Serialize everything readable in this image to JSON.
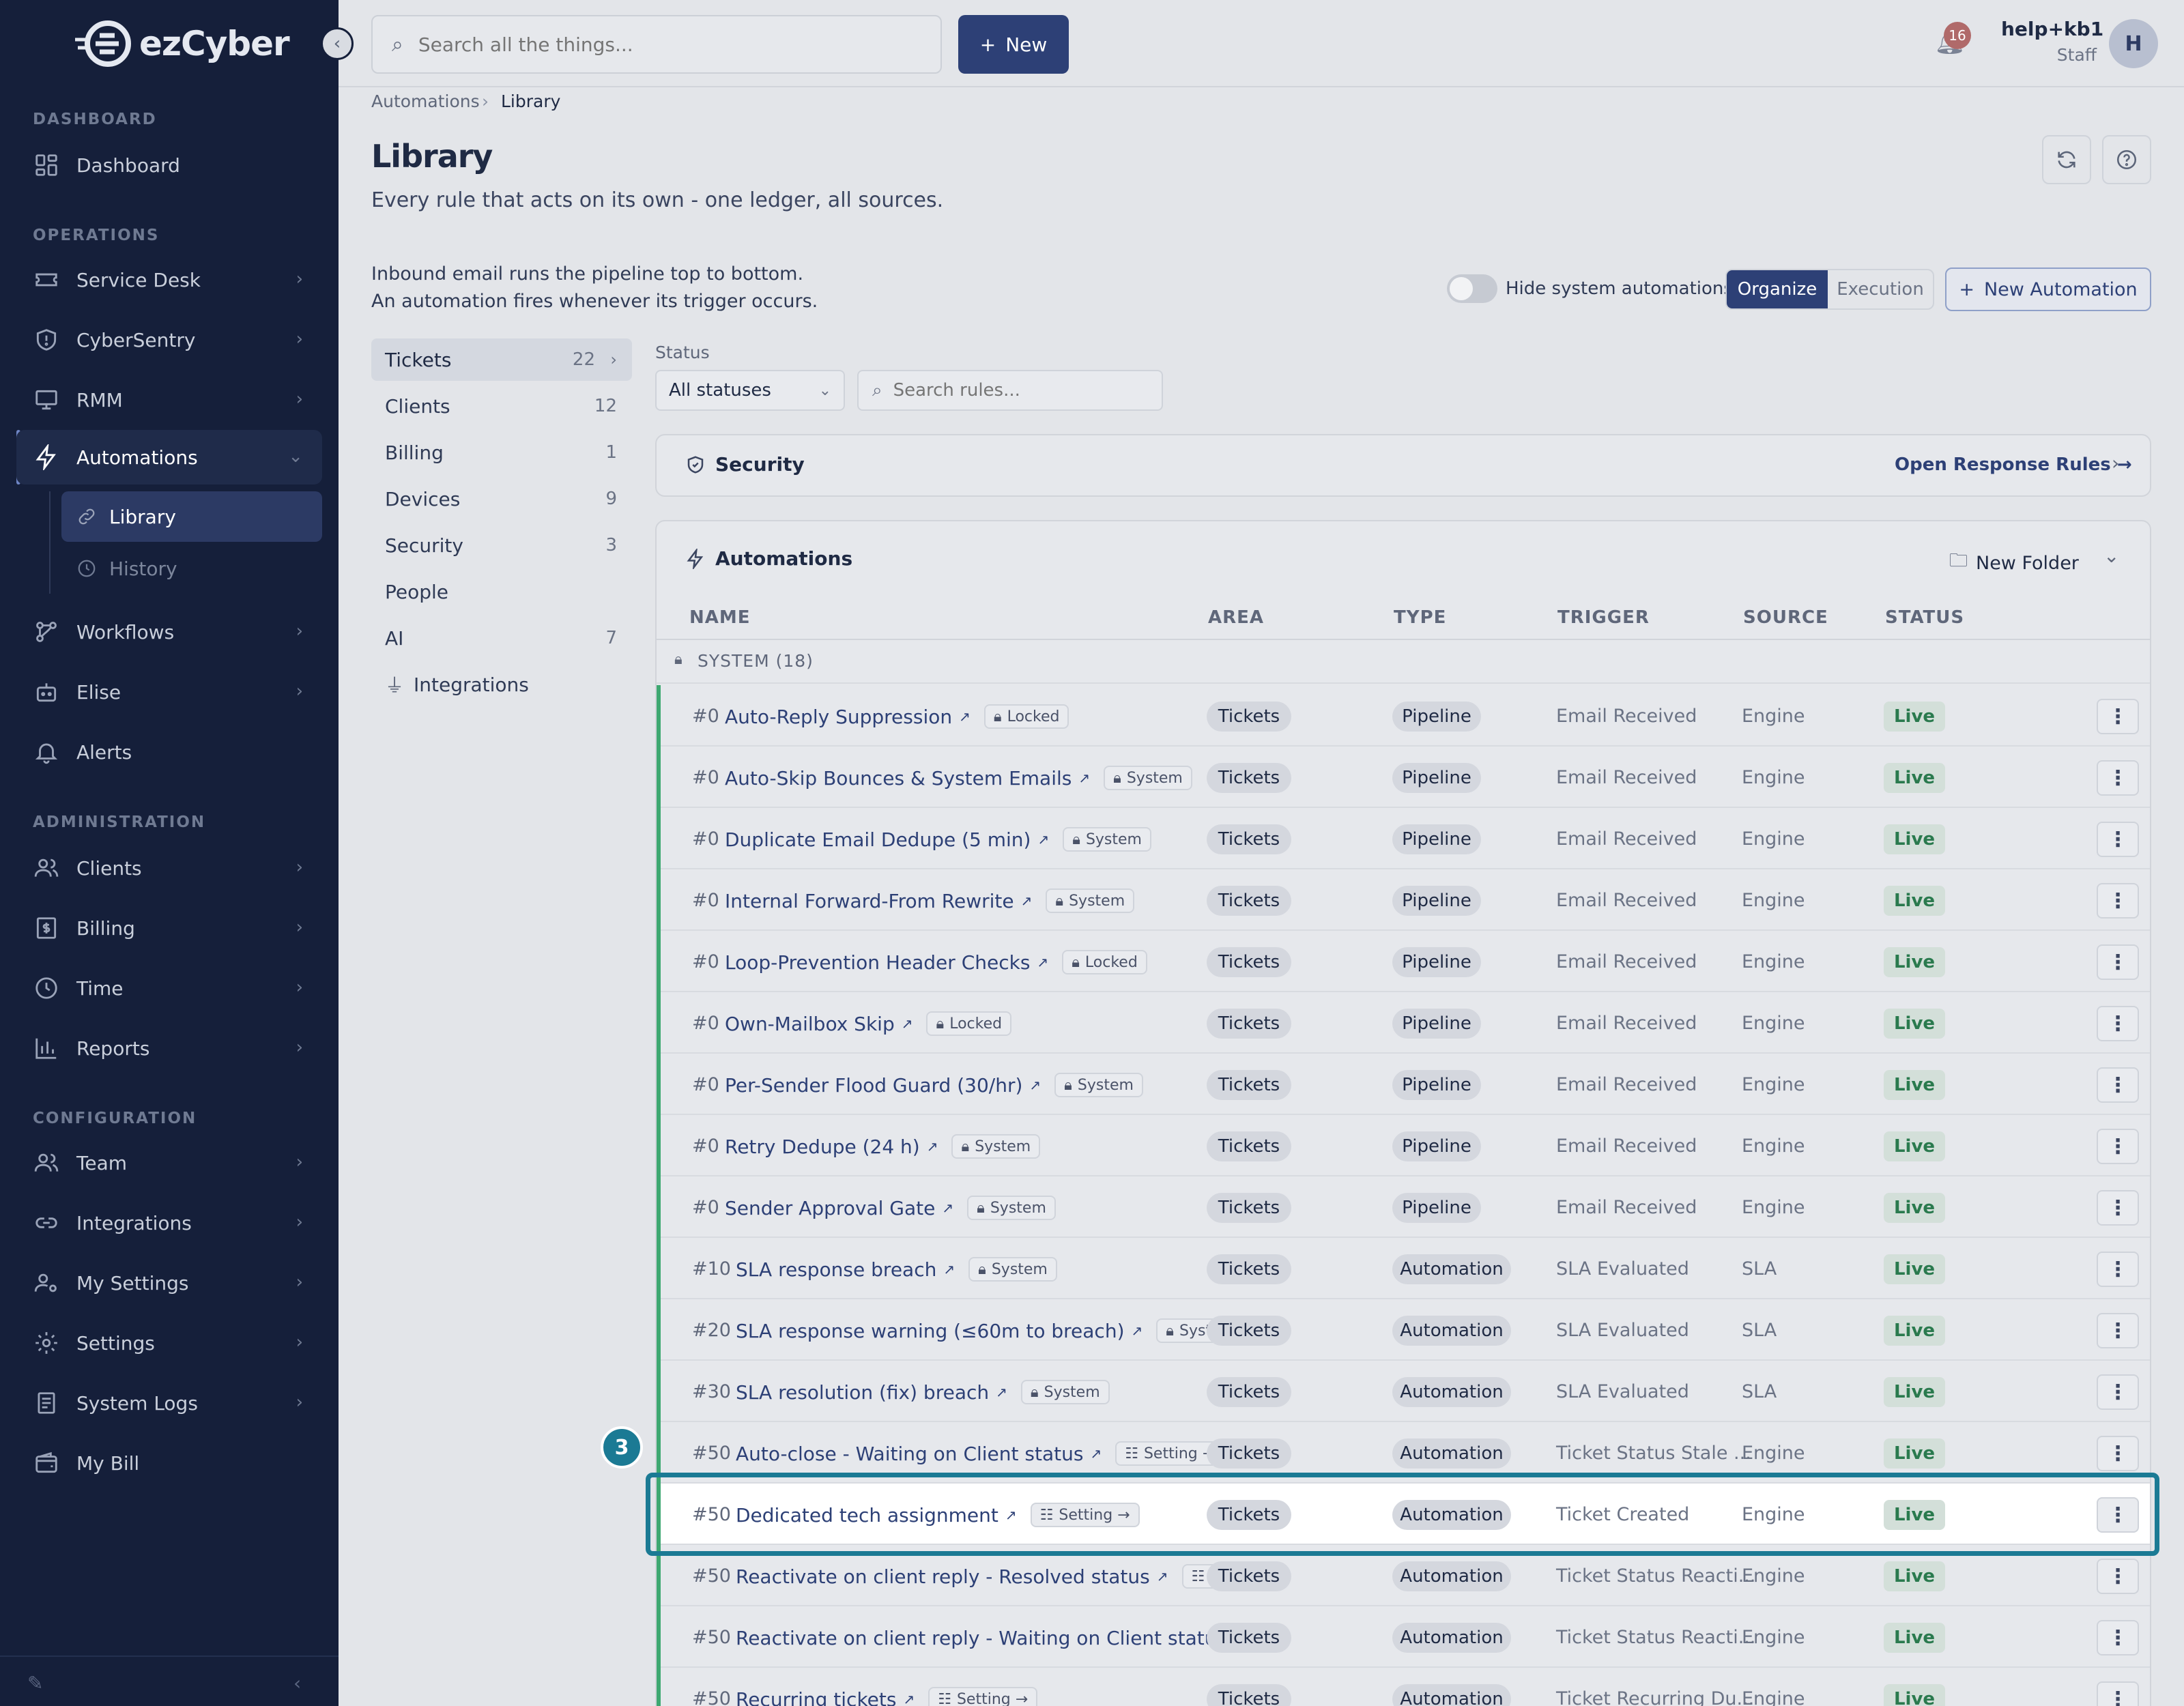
{
  "brand": {
    "logo_text": "ezCyber"
  },
  "sidebar": {
    "sections": {
      "dashboard": "DASHBOARD",
      "operations": "OPERATIONS",
      "administration": "ADMINISTRATION",
      "configuration": "CONFIGURATION"
    },
    "items": [
      {
        "label": "Dashboard"
      },
      {
        "label": "Service Desk"
      },
      {
        "label": "CyberSentry"
      },
      {
        "label": "RMM"
      },
      {
        "label": "Automations"
      },
      {
        "label": "Workflows"
      },
      {
        "label": "Elise"
      },
      {
        "label": "Alerts"
      },
      {
        "label": "Clients"
      },
      {
        "label": "Billing"
      },
      {
        "label": "Time"
      },
      {
        "label": "Reports"
      },
      {
        "label": "Team"
      },
      {
        "label": "Integrations"
      },
      {
        "label": "My Settings"
      },
      {
        "label": "Settings"
      },
      {
        "label": "System Logs"
      },
      {
        "label": "My Bill"
      }
    ],
    "sub_items": [
      {
        "label": "Library"
      },
      {
        "label": "History"
      }
    ]
  },
  "topbar": {
    "search_placeholder": "Search all the things...",
    "new_label": "New",
    "notification_count": "16",
    "user_name": "help+kb1",
    "user_role": "Staff",
    "avatar_initial": "H"
  },
  "breadcrumb": {
    "parent": "Automations",
    "current": "Library"
  },
  "page": {
    "title": "Library",
    "subtitle": "Every rule that acts on its own - one ledger, all sources.",
    "info_line1": "Inbound email runs the pipeline top to bottom.",
    "info_line2": "An automation fires whenever its trigger occurs."
  },
  "controls": {
    "hide_system_label": "Hide system automations",
    "hide_system_on": false,
    "mode_organize": "Organize",
    "mode_execution": "Execution",
    "new_automation": "New Automation"
  },
  "categories": [
    {
      "label": "Tickets",
      "count": "22"
    },
    {
      "label": "Clients",
      "count": "12"
    },
    {
      "label": "Billing",
      "count": "1"
    },
    {
      "label": "Devices",
      "count": "9"
    },
    {
      "label": "Security",
      "count": "3"
    },
    {
      "label": "People",
      "count": ""
    },
    {
      "label": "AI",
      "count": "7"
    },
    {
      "label": "Integrations",
      "count": ""
    }
  ],
  "filters": {
    "status_label": "Status",
    "status_value": "All statuses",
    "search_placeholder": "Search rules..."
  },
  "security_panel": {
    "title": "Security",
    "link": "Open Response Rules"
  },
  "automations_panel": {
    "title": "Automations",
    "new_folder": "New Folder"
  },
  "table": {
    "headers": {
      "name": "NAME",
      "area": "AREA",
      "type": "TYPE",
      "trigger": "TRIGGER",
      "source": "SOURCE",
      "status": "STATUS"
    },
    "group": "SYSTEM  (18)",
    "rows": [
      {
        "num": "#0",
        "name": "Auto-Reply Suppression",
        "tag": "Locked",
        "area": "Tickets",
        "type": "Pipeline",
        "trigger": "Email Received",
        "source": "Engine",
        "status": "Live"
      },
      {
        "num": "#0",
        "name": "Auto-Skip Bounces & System Emails",
        "tag": "System",
        "area": "Tickets",
        "type": "Pipeline",
        "trigger": "Email Received",
        "source": "Engine",
        "status": "Live"
      },
      {
        "num": "#0",
        "name": "Duplicate Email Dedupe (5 min)",
        "tag": "System",
        "area": "Tickets",
        "type": "Pipeline",
        "trigger": "Email Received",
        "source": "Engine",
        "status": "Live"
      },
      {
        "num": "#0",
        "name": "Internal Forward-From Rewrite",
        "tag": "System",
        "area": "Tickets",
        "type": "Pipeline",
        "trigger": "Email Received",
        "source": "Engine",
        "status": "Live"
      },
      {
        "num": "#0",
        "name": "Loop-Prevention Header Checks",
        "tag": "Locked",
        "area": "Tickets",
        "type": "Pipeline",
        "trigger": "Email Received",
        "source": "Engine",
        "status": "Live"
      },
      {
        "num": "#0",
        "name": "Own-Mailbox Skip",
        "tag": "Locked",
        "area": "Tickets",
        "type": "Pipeline",
        "trigger": "Email Received",
        "source": "Engine",
        "status": "Live"
      },
      {
        "num": "#0",
        "name": "Per-Sender Flood Guard (30/hr)",
        "tag": "System",
        "area": "Tickets",
        "type": "Pipeline",
        "trigger": "Email Received",
        "source": "Engine",
        "status": "Live"
      },
      {
        "num": "#0",
        "name": "Retry Dedupe (24 h)",
        "tag": "System",
        "area": "Tickets",
        "type": "Pipeline",
        "trigger": "Email Received",
        "source": "Engine",
        "status": "Live"
      },
      {
        "num": "#0",
        "name": "Sender Approval Gate",
        "tag": "System",
        "area": "Tickets",
        "type": "Pipeline",
        "trigger": "Email Received",
        "source": "Engine",
        "status": "Live"
      },
      {
        "num": "#10",
        "name": "SLA response breach",
        "tag": "System",
        "area": "Tickets",
        "type": "Automation",
        "trigger": "SLA Evaluated",
        "source": "SLA",
        "status": "Live"
      },
      {
        "num": "#20",
        "name": "SLA response warning (≤60m to breach)",
        "tag": "System",
        "area": "Tickets",
        "type": "Automation",
        "trigger": "SLA Evaluated",
        "source": "SLA",
        "status": "Live"
      },
      {
        "num": "#30",
        "name": "SLA resolution (fix) breach",
        "tag": "System",
        "area": "Tickets",
        "type": "Automation",
        "trigger": "SLA Evaluated",
        "source": "SLA",
        "status": "Live"
      },
      {
        "num": "#50",
        "name": "Auto-close - Waiting on Client status",
        "tag": "Setting →",
        "area": "Tickets",
        "type": "Automation",
        "trigger": "Ticket Status Stale ...",
        "source": "Engine",
        "status": "Live"
      },
      {
        "num": "#50",
        "name": "Dedicated tech assignment",
        "tag": "Setting →",
        "area": "Tickets",
        "type": "Automation",
        "trigger": "Ticket Created",
        "source": "Engine",
        "status": "Live"
      },
      {
        "num": "#50",
        "name": "Reactivate on client reply - Resolved status",
        "tag": "Setting",
        "area": "Tickets",
        "type": "Automation",
        "trigger": "Ticket Status Reacti...",
        "source": "Engine",
        "status": "Live"
      },
      {
        "num": "#50",
        "name": "Reactivate on client reply - Waiting on Client status",
        "tag": "⋮",
        "area": "Tickets",
        "type": "Automation",
        "trigger": "Ticket Status Reacti...",
        "source": "Engine",
        "status": "Live"
      },
      {
        "num": "#50",
        "name": "Recurring tickets",
        "tag": "Setting →",
        "area": "Tickets",
        "type": "Automation",
        "trigger": "Ticket Recurring Du...",
        "source": "Engine",
        "status": "Live"
      }
    ]
  },
  "step_marker": "3",
  "colors": {
    "sidebar_bg": "#151f3a",
    "primary": "#2d4076",
    "live_green": "#2a7a4e",
    "highlight": "#1b7a94"
  }
}
